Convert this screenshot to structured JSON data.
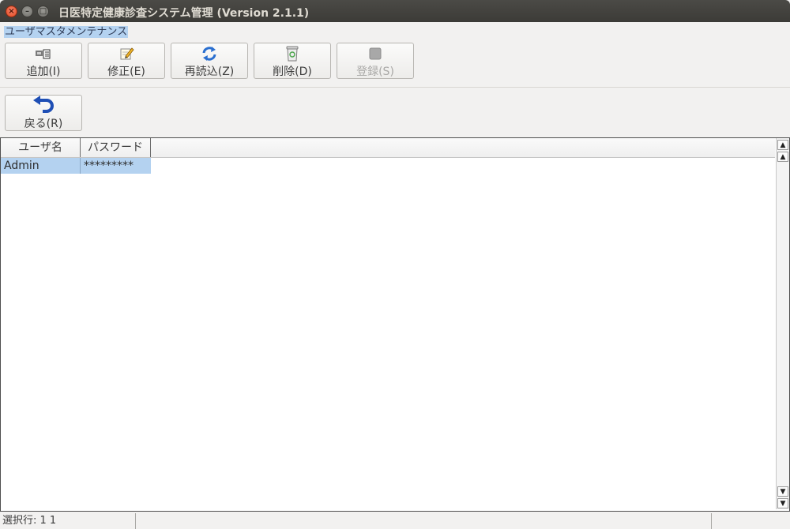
{
  "window": {
    "title": "日医特定健康診査システム管理 (Version 2.1.1)"
  },
  "screen_label": "ユーザマスタメンテナンス",
  "toolbar": {
    "add_label": "追加(I)",
    "edit_label": "修正(E)",
    "reload_label": "再読込(Z)",
    "delete_label": "削除(D)",
    "register_label": "登録(S)",
    "back_label": "戻る(R)"
  },
  "table": {
    "headers": [
      "ユーザ名",
      "パスワード"
    ],
    "rows": [
      [
        "Admin",
        "*********"
      ]
    ]
  },
  "status": {
    "selected_row": "選択行: 1  1"
  },
  "icons": {
    "add": "add-record-icon",
    "edit": "edit-icon",
    "reload": "reload-icon",
    "delete": "trash-icon",
    "register": "register-icon",
    "back": "back-arrow-icon"
  },
  "colors": {
    "selection": "#b4d2f0",
    "titlebar": "#3c3b37",
    "close_button": "#e2481f"
  }
}
